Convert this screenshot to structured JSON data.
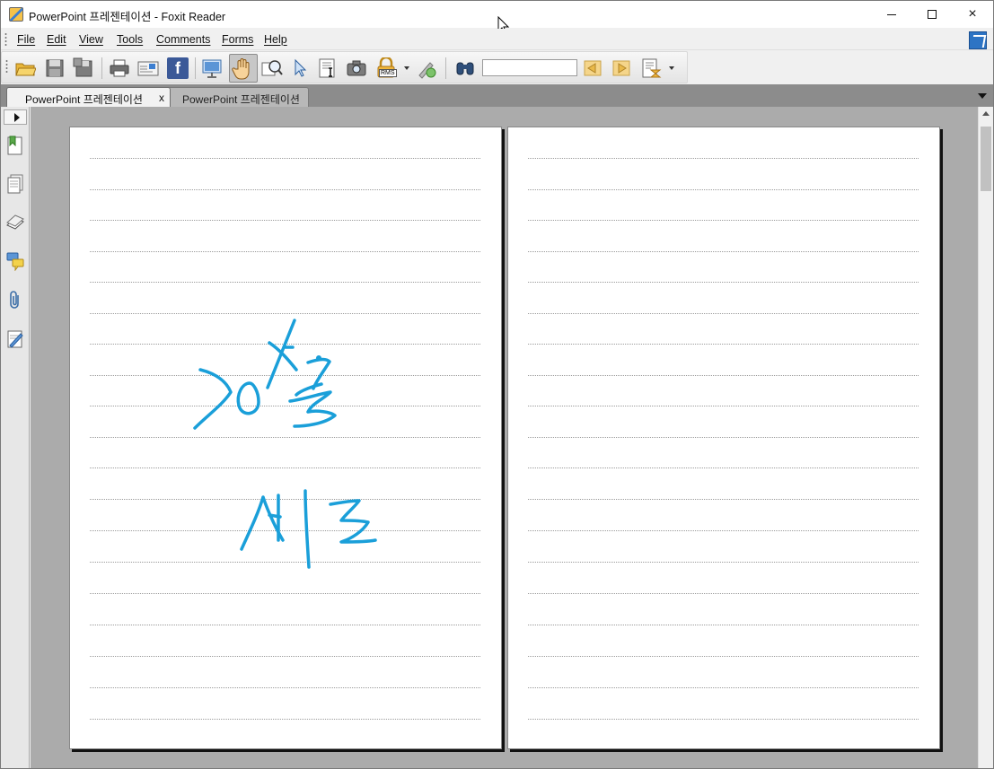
{
  "window": {
    "title": "PowerPoint 프레젠테이션 - Foxit Reader",
    "controls": {
      "minimize": "minimize-button",
      "maximize": "maximize-button",
      "close": "×"
    }
  },
  "menu": {
    "items": [
      "File",
      "Edit",
      "View",
      "Tools",
      "Comments",
      "Forms",
      "Help"
    ]
  },
  "toolbar": {
    "icons": [
      "open-folder-icon",
      "save-icon",
      "save-as-icon",
      "print-icon",
      "email-icon",
      "facebook-icon",
      "presentation-icon",
      "hand-tool-icon",
      "snapshot-zoom-icon",
      "select-icon",
      "select-text-icon",
      "camera-icon",
      "rms-lock-icon",
      "sign-icon",
      "find-binoculars-icon",
      "previous-result-icon",
      "next-result-icon",
      "typewriter-icon"
    ],
    "find_value": "",
    "rms_label": "RMS",
    "facebook_label": "f"
  },
  "tabs": [
    {
      "label": "PowerPoint 프레젠테이션",
      "active": true,
      "close": "x"
    },
    {
      "label": "PowerPoint 프레젠테이션",
      "active": false
    }
  ],
  "left_panel": {
    "icons": [
      "bookmark-panel-icon",
      "pages-panel-icon",
      "layers-panel-icon",
      "comments-panel-icon",
      "attachments-panel-icon",
      "signatures-panel-icon"
    ]
  },
  "document": {
    "handwriting": {
      "line1": "고양초",
      "line2": "세로",
      "ink_color": "#1a9fd9"
    },
    "page_count_visible": 2,
    "ruled_lines_per_page": 19
  },
  "colors": {
    "accent": "#2d74c4",
    "canvas": "#ababab",
    "ink": "#1a9fd9"
  }
}
